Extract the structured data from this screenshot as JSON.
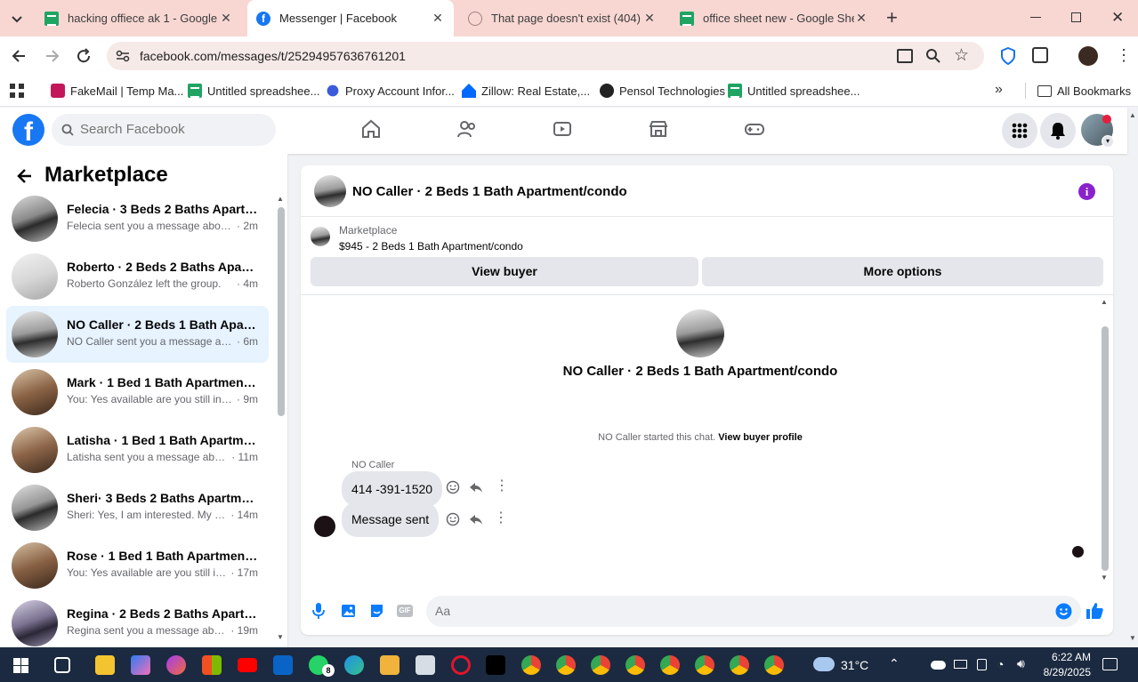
{
  "browser": {
    "tabs": [
      {
        "title": "hacking offiece ak 1 - Google Sh",
        "icon": "sheets-icon",
        "active": false
      },
      {
        "title": "Messenger | Facebook",
        "icon": "facebook-icon",
        "active": true
      },
      {
        "title": "That page doesn't exist (404) - F",
        "icon": "error-page-icon",
        "active": false
      },
      {
        "title": "office sheet new - Google Shee",
        "icon": "sheets-icon",
        "active": false
      }
    ],
    "url": "facebook.com/messages/t/25294957636761201",
    "bookmarks": [
      {
        "label": "FakeMail | Temp Ma..."
      },
      {
        "label": "Untitled spreadshee..."
      },
      {
        "label": "Proxy Account Infor..."
      },
      {
        "label": "Zillow: Real Estate,..."
      },
      {
        "label": "Pensol Technologies"
      },
      {
        "label": "Untitled spreadshee..."
      }
    ],
    "all_bookmarks": "All Bookmarks"
  },
  "facebook": {
    "logo": "f",
    "search_placeholder": "Search Facebook",
    "brand_color": "#1877f2"
  },
  "sidebar": {
    "title": "Marketplace",
    "conversations": [
      {
        "name": "Felecia · 3 Beds 2 Baths Apartm...",
        "snippet": "Felecia sent you a message about ...",
        "time": "· 2m",
        "selected": false
      },
      {
        "name": "Roberto · 2 Beds 2 Baths Apart...",
        "snippet": "Roberto González left the group.",
        "time": "· 4m",
        "selected": false
      },
      {
        "name": "NO Caller · 2 Beds 1 Bath Apart...",
        "snippet": "NO Caller sent you a message abo...",
        "time": "· 6m",
        "selected": true
      },
      {
        "name": "Mark · 1 Bed 1 Bath Apartment/...",
        "snippet": "You: Yes available are you still inter...",
        "time": "· 9m",
        "selected": false
      },
      {
        "name": "Latisha · 1 Bed 1 Bath Apartment...",
        "snippet": "Latisha sent you a message abou...",
        "time": "· 11m",
        "selected": false
      },
      {
        "name": "Sheri· 3 Beds 2 Baths Apartment...",
        "snippet": "Sheri: Yes, I am interested. My nu...",
        "time": "· 14m",
        "selected": false
      },
      {
        "name": "Rose · 1 Bed 1 Bath Apartment/c...",
        "snippet": "You: Yes available are you still int...",
        "time": "· 17m",
        "selected": false
      },
      {
        "name": "Regina · 2 Beds 2 Baths Apartm...",
        "snippet": "Regina sent you a message abou...",
        "time": "· 19m",
        "selected": false
      }
    ]
  },
  "chat": {
    "header_title": "NO Caller · 2 Beds 1 Bath Apartment/condo",
    "listing": {
      "source": "Marketplace",
      "price_title": "$945 - 2 Beds 1 Bath Apartment/condo"
    },
    "view_buyer": "View buyer",
    "more_options": "More options",
    "intro_title": "NO Caller · 2 Beds 1 Bath Apartment/condo",
    "started_text": "NO Caller started this chat.",
    "view_buyer_profile": "View buyer profile",
    "sender_name": "NO Caller",
    "messages": [
      {
        "text": "414 -391-1520"
      },
      {
        "text": "Message sent"
      }
    ],
    "composer_placeholder": "Aa"
  },
  "taskbar": {
    "weather": "31°C",
    "time": "6:22 AM",
    "date": "8/29/2025",
    "whatsapp_badge": "8"
  }
}
